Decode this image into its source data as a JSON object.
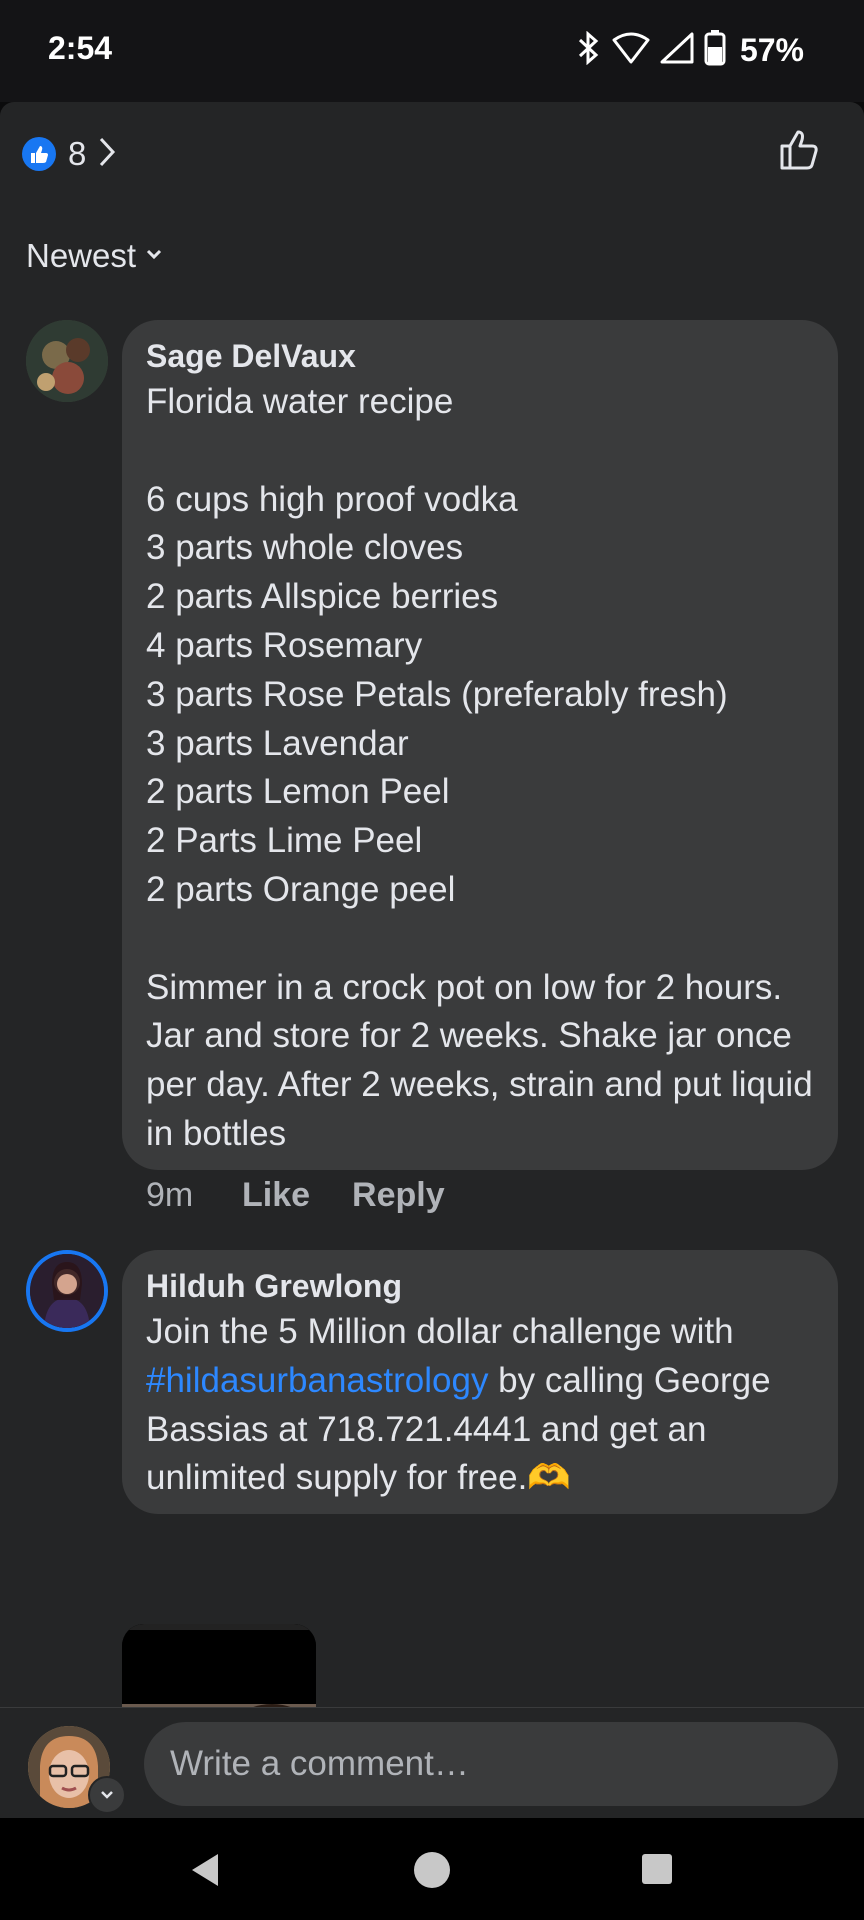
{
  "status_bar": {
    "time": "2:54",
    "battery": "57%"
  },
  "reactions": {
    "count": "8"
  },
  "sort": {
    "label": "Newest"
  },
  "comments": [
    {
      "author": "Sage DelVaux",
      "body": "Florida water recipe\n\n6 cups high proof vodka\n3 parts whole cloves\n2 parts Allspice berries\n4 parts Rosemary\n3 parts Rose Petals (preferably fresh)\n3 parts Lavendar\n2 parts Lemon Peel\n2 Parts Lime Peel\n2 parts Orange peel\n\nSimmer in a crock pot on low for 2 hours. Jar and store for 2 weeks. Shake jar once per day. After 2 weeks, strain and put liquid in bottles",
      "time": "9m",
      "like_label": "Like",
      "reply_label": "Reply"
    },
    {
      "author": "Hilduh Grewlong",
      "body_before": "Join the 5 Million dollar challenge with ",
      "hashtag": "#hildasurbanastrology",
      "body_after": " by calling George Bassias at 718.721.4441 and get an unlimited supply for free.🫶"
    }
  ],
  "composer": {
    "placeholder": "Write a comment…"
  },
  "colors": {
    "accent": "#1877f2",
    "hashtag": "#2d88ff",
    "bubble": "#3a3b3c",
    "sheet": "#242526"
  },
  "icons": [
    "bluetooth-icon",
    "wifi-icon",
    "signal-icon",
    "battery-icon",
    "like-badge-icon",
    "chevron-right-icon",
    "thumbs-up-outline-icon",
    "chevron-down-icon",
    "back-icon",
    "home-icon",
    "recents-icon"
  ]
}
